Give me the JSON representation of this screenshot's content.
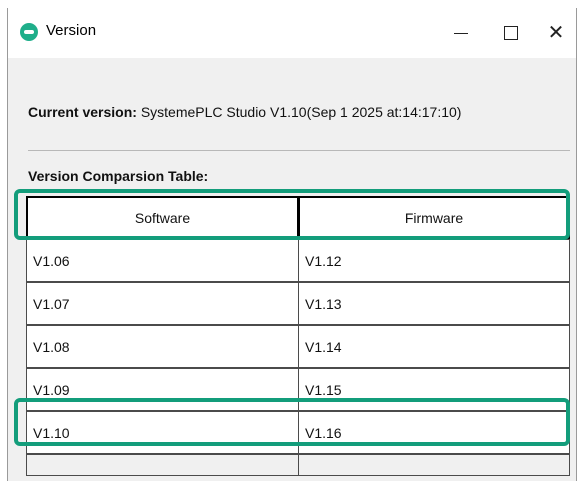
{
  "window": {
    "title": "Version",
    "icon": "app-logo-icon",
    "controls": {
      "minimize": "minimize-icon",
      "maximize": "maximize-icon",
      "close": "close-icon"
    }
  },
  "current": {
    "label": "Current version:",
    "value": "SystemePLC Studio V1.10(Sep  1 2025 at:14:17:10)"
  },
  "table": {
    "caption": "Version Comparsion Table:",
    "headers": [
      "Software",
      "Firmware"
    ],
    "rows": [
      [
        "V1.06",
        "V1.12"
      ],
      [
        "V1.07",
        "V1.13"
      ],
      [
        "V1.08",
        "V1.14"
      ],
      [
        "V1.09",
        "V1.15"
      ],
      [
        "V1.10",
        "V1.16"
      ]
    ]
  },
  "highlight_color": "#139d7b"
}
